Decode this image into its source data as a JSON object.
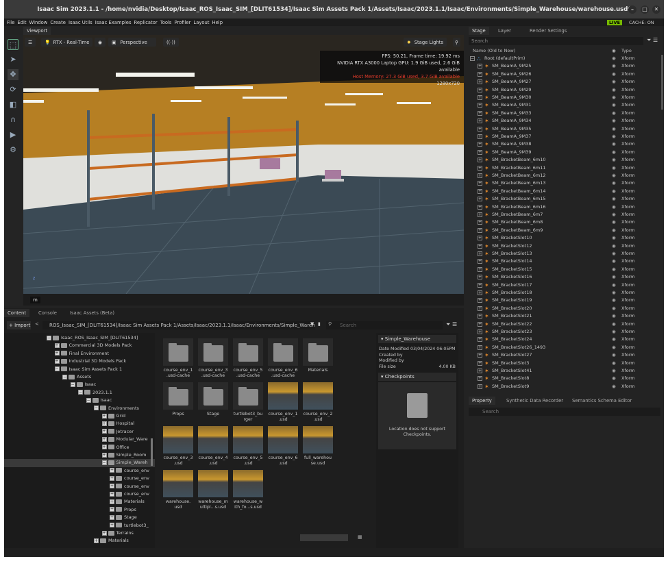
{
  "window": {
    "title": "Isaac Sim 2023.1.1 - /home/nvidia/Desktop/Isaac_ROS_Isaac_SIM_[DLIT61534]/Isaac Sim Assets Pack 1/Assets/Isaac/2023.1.1/Isaac/Environments/Simple_Warehouse/warehouse.usd*",
    "min": "–",
    "max": "□",
    "close": "✕"
  },
  "menu": [
    "File",
    "Edit",
    "Window",
    "Create",
    "Isaac Utils",
    "Isaac Examples",
    "Replicator",
    "Tools",
    "Profiler",
    "Layout",
    "Help"
  ],
  "live": {
    "label": "LIVE",
    "cache": "CACHE: ON"
  },
  "viewport": {
    "tab": "Viewport",
    "renderer": "RTX - Real-Time",
    "camera": "Perspective",
    "lights": "Stage Lights",
    "stats": [
      "FPS: 50.21, Frame time: 19.92 ms",
      "NVIDIA RTX A3000 Laptop GPU: 1.9 GiB used, 2.6 GiB available",
      "Host Memory: 27.3 GiB used, 3.7 GiB available",
      "1280x720"
    ],
    "unit": "m",
    "axis": "z"
  },
  "stage": {
    "tabs": [
      "Stage",
      "Layer",
      "Render Settings"
    ],
    "search": "Search",
    "col_name": "Name (Old to New)",
    "col_type": "Type",
    "root": "Root (defaultPrim)",
    "rows": [
      "SM_BeamA_9M25",
      "SM_BeamA_9M26",
      "SM_BeamA_9M27",
      "SM_BeamA_9M29",
      "SM_BeamA_9M30",
      "SM_BeamA_9M31",
      "SM_BeamA_9M33",
      "SM_BeamA_9M34",
      "SM_BeamA_9M35",
      "SM_BeamA_9M37",
      "SM_BeamA_9M38",
      "SM_BeamA_9M39",
      "SM_BracketBeam_6m10",
      "SM_BracketBeam_6m11",
      "SM_BracketBeam_6m12",
      "SM_BracketBeam_6m13",
      "SM_BracketBeam_6m14",
      "SM_BracketBeam_6m15",
      "SM_BracketBeam_6m16",
      "SM_BracketBeam_6m7",
      "SM_BracketBeam_6m8",
      "SM_BracketBeam_6m9",
      "SM_BracketSlot10",
      "SM_BracketSlot12",
      "SM_BracketSlot13",
      "SM_BracketSlot14",
      "SM_BracketSlot15",
      "SM_BracketSlot16",
      "SM_BracketSlot17",
      "SM_BracketSlot18",
      "SM_BracketSlot19",
      "SM_BracketSlot20",
      "SM_BracketSlot21",
      "SM_BracketSlot22",
      "SM_BracketSlot23",
      "SM_BracketSlot24",
      "SM_BracketSlot26_1493",
      "SM_BracketSlot27",
      "SM_BracketSlot3",
      "SM_BracketSlot41",
      "SM_BracketSlot8",
      "SM_BracketSlot9"
    ],
    "type": "Xform"
  },
  "property": {
    "tabs": [
      "Property",
      "Synthetic Data Recorder",
      "Semantics Schema Editor"
    ],
    "search": "Search"
  },
  "content": {
    "tabs": [
      "Content",
      "Console",
      "Isaac Assets (Beta)"
    ],
    "import": "Import",
    "path": "ROS_Isaac_SIM_[DLIT61534]/Isaac Sim Assets Pack 1/Assets/Isaac/2023.1.1/Isaac/Environments/Simple_Warehouse/",
    "search": "Search",
    "tree": [
      [
        "Isaac_ROS_Isaac_SIM_[DLIT61534]",
        0,
        "−"
      ],
      [
        "Commercial 3D Models Pack",
        1,
        "+"
      ],
      [
        "Final Environment",
        1,
        "+"
      ],
      [
        "Industrial 3D Models Pack",
        1,
        "+"
      ],
      [
        "Isaac Sim Assets Pack 1",
        1,
        "−"
      ],
      [
        "Assets",
        2,
        "−"
      ],
      [
        "Isaac",
        3,
        "−"
      ],
      [
        "2023.1.1",
        4,
        "−"
      ],
      [
        "Isaac",
        5,
        "−"
      ],
      [
        "Environments",
        6,
        "−"
      ],
      [
        "Grid",
        7,
        "+"
      ],
      [
        "Hospital",
        7,
        "+"
      ],
      [
        "Jetracer",
        7,
        "+"
      ],
      [
        "Modular_Ware",
        7,
        "+"
      ],
      [
        "Office",
        7,
        "+"
      ],
      [
        "Simple_Room",
        7,
        "+"
      ],
      [
        "Simple_Wareh",
        7,
        "−"
      ],
      [
        "course_env",
        8,
        "+"
      ],
      [
        "course_env",
        8,
        "+"
      ],
      [
        "course_env",
        8,
        "+"
      ],
      [
        "course_env",
        8,
        "+"
      ],
      [
        "Materials",
        8,
        "+"
      ],
      [
        "Props",
        8,
        "+"
      ],
      [
        "Stage",
        8,
        "+"
      ],
      [
        "turtlebot3_",
        8,
        "+"
      ],
      [
        "Terrains",
        7,
        "+"
      ],
      [
        "Materials",
        6,
        "+"
      ]
    ],
    "files": [
      [
        "course_env_1 .usd-cache",
        "folder"
      ],
      [
        "course_env_3 .usd-cache",
        "folder"
      ],
      [
        "course_env_5 .usd-cache",
        "folder"
      ],
      [
        "course_env_6 .usd-cache",
        "folder"
      ],
      [
        "Materials",
        "folder"
      ],
      [
        "Props",
        "folder"
      ],
      [
        "Stage",
        "folder"
      ],
      [
        "turtlebot3_bu rger",
        "folder"
      ],
      [
        "course_env_1 .usd",
        "scene"
      ],
      [
        "course_env_2 .usd",
        "scene"
      ],
      [
        "course_env_3 .usd",
        "scene"
      ],
      [
        "course_env_4 .usd",
        "scene"
      ],
      [
        "course_env_5 .usd",
        "scene"
      ],
      [
        "course_env_6 .usd",
        "scene"
      ],
      [
        "full_warehou se.usd",
        "scene"
      ],
      [
        "warehouse. usd",
        "scene"
      ],
      [
        "warehouse_m ultipl...s.usd",
        "scene"
      ],
      [
        "warehouse_w ith_fo...s.usd",
        "scene"
      ]
    ],
    "info": {
      "title": "Simple_Warehouse",
      "date_label": "Date Modified",
      "date": "03/04/2024 06:05PM",
      "created": "Created by",
      "modified": "Modified by",
      "size_label": "File size",
      "size": "4.00 KB",
      "checkpoints": "Checkpoints",
      "no_support": "Location does not support Checkpoints."
    }
  }
}
